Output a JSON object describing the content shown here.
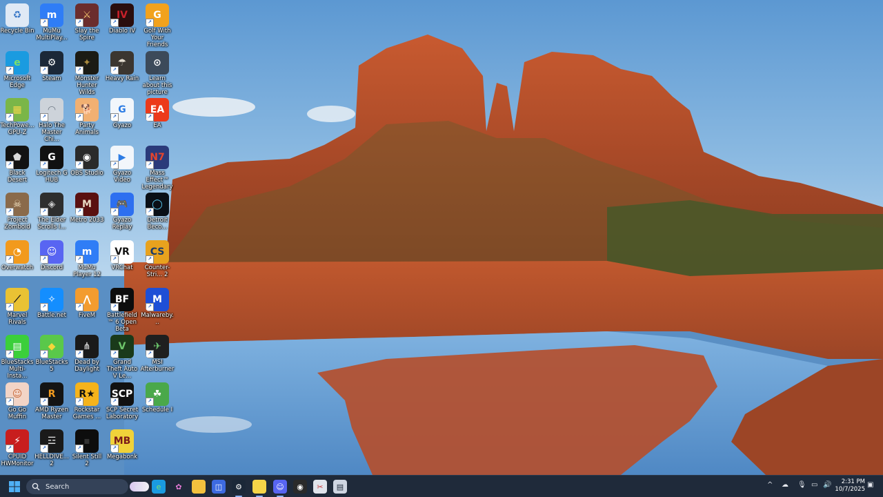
{
  "desktop_icons": [
    {
      "label": "Recycle Bin",
      "icon": "recycle-bin-icon",
      "bg": "#dfe9f5",
      "glyph": "♻",
      "fg": "#3c7ac8",
      "shortcut": false
    },
    {
      "label": "MuMu MultiPlay...",
      "icon": "mumu-multiplayer-icon",
      "bg": "#2f7df6",
      "glyph": "m",
      "fg": "#fff",
      "shortcut": true
    },
    {
      "label": "Slay the Spire",
      "icon": "slay-the-spire-icon",
      "bg": "#6b2d2d",
      "glyph": "⚔",
      "fg": "#f2c46e",
      "shortcut": true
    },
    {
      "label": "Diablo IV",
      "icon": "diablo-iv-icon",
      "bg": "#2a0e0e",
      "glyph": "IV",
      "fg": "#c8202a",
      "shortcut": true
    },
    {
      "label": "Golf With Your Friends",
      "icon": "golf-with-your-friends-icon",
      "bg": "#f2a21d",
      "glyph": "G",
      "fg": "#fff",
      "shortcut": true
    },
    {
      "label": "Microsoft Edge",
      "icon": "microsoft-edge-icon",
      "bg": "#1a9be0",
      "glyph": "e",
      "fg": "#7de06a",
      "shortcut": true
    },
    {
      "label": "Steam",
      "icon": "steam-icon",
      "bg": "#1b2838",
      "glyph": "⚙",
      "fg": "#fff",
      "shortcut": true
    },
    {
      "label": "Monster Hunter Wilds",
      "icon": "monster-hunter-wilds-icon",
      "bg": "#1b1b14",
      "glyph": "✦",
      "fg": "#a98a3e",
      "shortcut": true
    },
    {
      "label": "Heavy Rain",
      "icon": "heavy-rain-icon",
      "bg": "#3b3630",
      "glyph": "☂",
      "fg": "#e4ddd0",
      "shortcut": true
    },
    {
      "label": "Learn about this picture",
      "icon": "learn-about-picture-icon",
      "bg": "#3c4a5a",
      "glyph": "⊙",
      "fg": "#fff",
      "shortcut": false
    },
    {
      "label": "TechPowe... GPU-Z",
      "icon": "gpu-z-icon",
      "bg": "#7ab648",
      "glyph": "▦",
      "fg": "#f5d64c",
      "shortcut": true
    },
    {
      "label": "Halo The Master Chi...",
      "icon": "halo-mcc-icon",
      "bg": "#cdd3da",
      "glyph": "◠",
      "fg": "#6b7580",
      "shortcut": true
    },
    {
      "label": "Party Animals",
      "icon": "party-animals-icon",
      "bg": "#f1b072",
      "glyph": "🐕",
      "fg": "#fff",
      "shortcut": true
    },
    {
      "label": "Gyazo",
      "icon": "gyazo-icon",
      "bg": "#f2f6fb",
      "glyph": "G",
      "fg": "#2d7ce4",
      "shortcut": true
    },
    {
      "label": "EA",
      "icon": "ea-icon",
      "bg": "#ec3a1a",
      "glyph": "EA",
      "fg": "#fff",
      "shortcut": true
    },
    {
      "label": "Black Desert",
      "icon": "black-desert-icon",
      "bg": "#121212",
      "glyph": "⬟",
      "fg": "#d9d9d9",
      "shortcut": true
    },
    {
      "label": "Logitech G HUB",
      "icon": "logitech-g-hub-icon",
      "bg": "#111111",
      "glyph": "G",
      "fg": "#fff",
      "shortcut": true
    },
    {
      "label": "OBS Studio",
      "icon": "obs-studio-icon",
      "bg": "#2a2a2a",
      "glyph": "◉",
      "fg": "#fff",
      "shortcut": true
    },
    {
      "label": "Gyazo Video",
      "icon": "gyazo-video-icon",
      "bg": "#f2f6fb",
      "glyph": "▶",
      "fg": "#2d7ce4",
      "shortcut": true
    },
    {
      "label": "Mass Effect™ Legendary ...",
      "icon": "mass-effect-icon",
      "bg": "#2b3a7a",
      "glyph": "N7",
      "fg": "#e6452d",
      "shortcut": true
    },
    {
      "label": "Project Zomboid",
      "icon": "project-zomboid-icon",
      "bg": "#8a6a4a",
      "glyph": "☠",
      "fg": "#f0e0c0",
      "shortcut": true
    },
    {
      "label": "The Elder Scrolls I...",
      "icon": "elder-scrolls-icon",
      "bg": "#2e2e2e",
      "glyph": "◈",
      "fg": "#c9c9c9",
      "shortcut": true
    },
    {
      "label": "Metro 2033",
      "icon": "metro-2033-icon",
      "bg": "#5a1010",
      "glyph": "M",
      "fg": "#e7d7c0",
      "shortcut": true
    },
    {
      "label": "Gyazo Replay",
      "icon": "gyazo-replay-icon",
      "bg": "#2d6ff0",
      "glyph": "🎮",
      "fg": "#fff",
      "shortcut": true
    },
    {
      "label": "Detroit Beco...",
      "icon": "detroit-become-human-icon",
      "bg": "#0a0f16",
      "glyph": "◯",
      "fg": "#59c8f0",
      "shortcut": true
    },
    {
      "label": "Overwatch",
      "icon": "overwatch-icon",
      "bg": "#f29a1d",
      "glyph": "◔",
      "fg": "#fff",
      "shortcut": true
    },
    {
      "label": "Discord",
      "icon": "discord-icon",
      "bg": "#5865f2",
      "glyph": "☺",
      "fg": "#fff",
      "shortcut": true
    },
    {
      "label": "MuMu Player 12",
      "icon": "mumu-player-icon",
      "bg": "#2f7df6",
      "glyph": "m",
      "fg": "#fff",
      "shortcut": true
    },
    {
      "label": "VRChat",
      "icon": "vrchat-icon",
      "bg": "#ffffff",
      "glyph": "VR",
      "fg": "#111",
      "shortcut": true
    },
    {
      "label": "Counter-Stri... 2",
      "icon": "counter-strike-2-icon",
      "bg": "#e8a21e",
      "glyph": "CS",
      "fg": "#1a3a6a",
      "shortcut": true
    },
    {
      "label": "Marvel Rivals",
      "icon": "marvel-rivals-icon",
      "bg": "#e9c234",
      "glyph": "⟋",
      "fg": "#1a1a1a",
      "shortcut": true
    },
    {
      "label": "Battle.net",
      "icon": "battle-net-icon",
      "bg": "#148eff",
      "glyph": "✧",
      "fg": "#fff",
      "shortcut": true
    },
    {
      "label": "FiveM",
      "icon": "fivem-icon",
      "bg": "#f39c2f",
      "glyph": "⋀",
      "fg": "#fff",
      "shortcut": true
    },
    {
      "label": "Battlefield™ 6 Open Beta",
      "icon": "battlefield-6-icon",
      "bg": "#0d0d0d",
      "glyph": "BF",
      "fg": "#fff",
      "shortcut": true
    },
    {
      "label": "Malwareby...",
      "icon": "malwarebytes-icon",
      "bg": "#1e4fd6",
      "glyph": "M",
      "fg": "#fff",
      "shortcut": true
    },
    {
      "label": "BlueStacks Multi-Insta...",
      "icon": "bluestacks-multi-instance-icon",
      "bg": "#3bcf3b",
      "glyph": "▤",
      "fg": "#fff",
      "shortcut": true
    },
    {
      "label": "BlueStacks 5",
      "icon": "bluestacks-5-icon",
      "bg": "#5ac84a",
      "glyph": "◆",
      "fg": "#f5d63a",
      "shortcut": true
    },
    {
      "label": "Dead by Daylight",
      "icon": "dead-by-daylight-icon",
      "bg": "#1a1a1a",
      "glyph": "⋔",
      "fg": "#ccc",
      "shortcut": true
    },
    {
      "label": "Grand Theft Auto V Le...",
      "icon": "gta-v-icon",
      "bg": "#1a3a1a",
      "glyph": "V",
      "fg": "#6dc46a",
      "shortcut": true
    },
    {
      "label": "MSI Afterburner",
      "icon": "msi-afterburner-icon",
      "bg": "#1f1f1f",
      "glyph": "✈",
      "fg": "#6fcb6f",
      "shortcut": true
    },
    {
      "label": "Go Go Muffin",
      "icon": "go-go-muffin-icon",
      "bg": "#f2d4c6",
      "glyph": "☺",
      "fg": "#c86a3a",
      "shortcut": true
    },
    {
      "label": "AMD Ryzen Master",
      "icon": "amd-ryzen-master-icon",
      "bg": "#141414",
      "glyph": "R",
      "fg": "#f39c1f",
      "shortcut": true
    },
    {
      "label": "Rockstar Games ...",
      "icon": "rockstar-games-icon",
      "bg": "#f5b31b",
      "glyph": "R★",
      "fg": "#111",
      "shortcut": true
    },
    {
      "label": "SCP Secret Laboratory",
      "icon": "scp-secret-laboratory-icon",
      "bg": "#111111",
      "glyph": "SCP",
      "fg": "#fff",
      "shortcut": true
    },
    {
      "label": "Schedule I",
      "icon": "schedule-i-icon",
      "bg": "#4aa84a",
      "glyph": "☘",
      "fg": "#fff",
      "shortcut": true
    },
    {
      "label": "CPUID HWMonitor",
      "icon": "cpuid-hwmonitor-icon",
      "bg": "#c81e1e",
      "glyph": "⚡",
      "fg": "#fff",
      "shortcut": true
    },
    {
      "label": "HELLDIVE... 2",
      "icon": "helldivers-2-icon",
      "bg": "#1a1a1a",
      "glyph": "☲",
      "fg": "#e8e8e8",
      "shortcut": true
    },
    {
      "label": "Silent Still 2",
      "icon": "silent-still-2-icon",
      "bg": "#0d0d0d",
      "glyph": "▪",
      "fg": "#333",
      "shortcut": true
    },
    {
      "label": "Megabonk",
      "icon": "megabonk-icon",
      "bg": "#f0d23a",
      "glyph": "MB",
      "fg": "#7a1a1a",
      "shortcut": true
    }
  ],
  "taskbar": {
    "search_placeholder": "Search",
    "pinned": [
      {
        "name": "task-view-icon",
        "glyph": "▭",
        "bg": "transparent",
        "fg": "#dfe6f0"
      },
      {
        "name": "edge-taskbar-icon",
        "glyph": "e",
        "bg": "#1a9be0",
        "fg": "#7de06a"
      },
      {
        "name": "copilot-taskbar-icon",
        "glyph": "✿",
        "bg": "transparent",
        "fg": "#e47ad6"
      },
      {
        "name": "file-explorer-taskbar-icon",
        "glyph": "▬",
        "bg": "#f3c13e",
        "fg": "#f3c13e"
      },
      {
        "name": "microsoft-store-taskbar-icon",
        "glyph": "◫",
        "bg": "#3d6ae0",
        "fg": "#fff"
      },
      {
        "name": "steam-taskbar-icon",
        "glyph": "⚙",
        "bg": "#1b2838",
        "fg": "#fff"
      },
      {
        "name": "sticky-notes-taskbar-icon",
        "glyph": "▮",
        "bg": "#f6d548",
        "fg": "#f6d548"
      },
      {
        "name": "discord-taskbar-icon",
        "glyph": "☺",
        "bg": "#5865f2",
        "fg": "#fff"
      },
      {
        "name": "obs-taskbar-icon",
        "glyph": "◉",
        "bg": "#2a2a2a",
        "fg": "#fff"
      },
      {
        "name": "snipping-tool-taskbar-icon",
        "glyph": "✂",
        "bg": "#e0e4ec",
        "fg": "#c83a3a"
      },
      {
        "name": "app-window-taskbar-icon",
        "glyph": "▤",
        "bg": "#cfd6e2",
        "fg": "#1f2a3a"
      }
    ],
    "tray": {
      "chevron": "^",
      "time": "2:31 PM",
      "date": "10/7/2025"
    }
  }
}
